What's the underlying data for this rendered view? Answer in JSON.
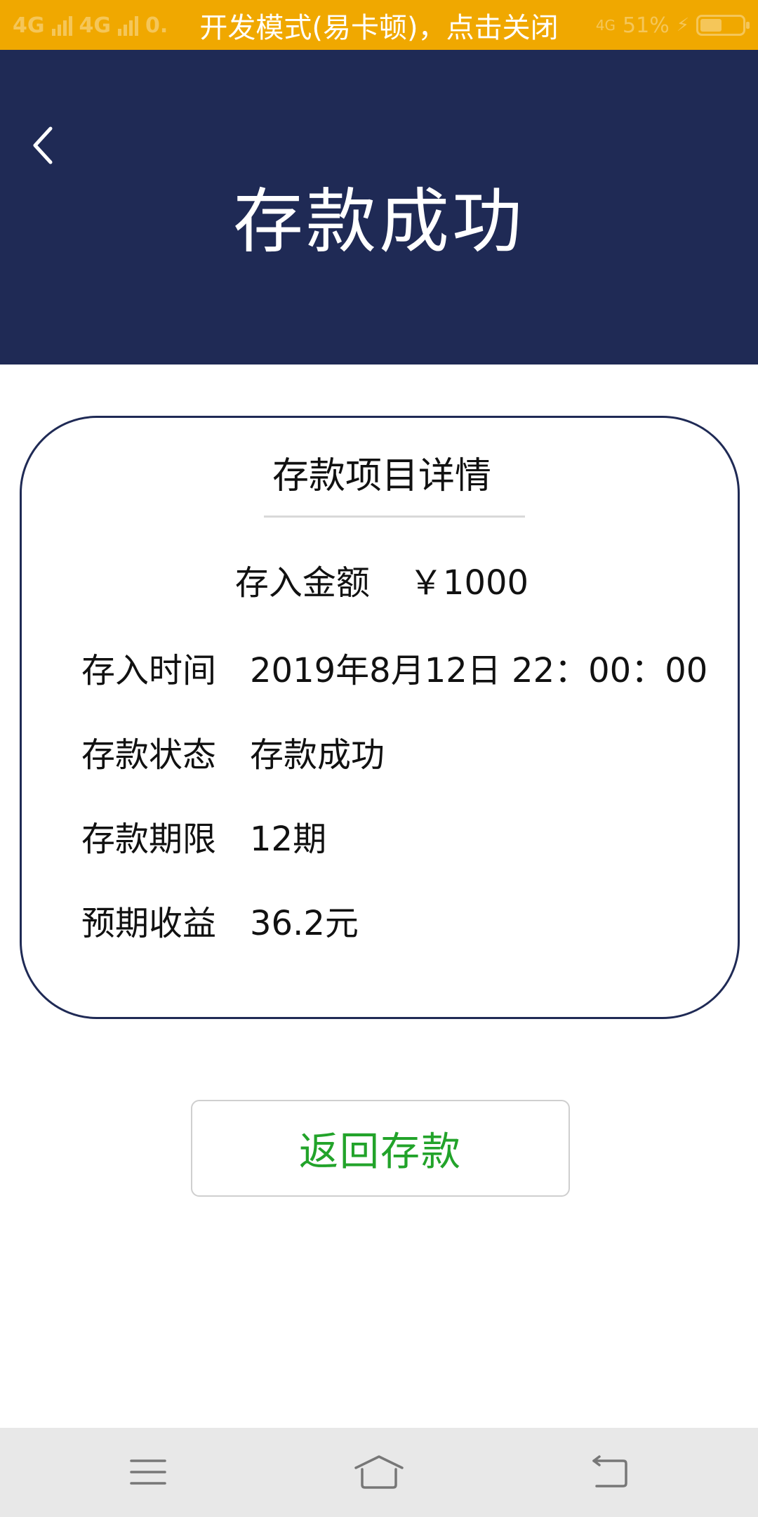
{
  "status_bar": {
    "signal_1": "4G",
    "signal_2": "4G",
    "speed": "0.",
    "network_right": "4G",
    "battery_text": "51%",
    "battery_level": 0.51,
    "charging_icon": "bolt-icon"
  },
  "dev_banner": {
    "text": "开发模式(易卡顿)，点击关闭"
  },
  "header": {
    "back_icon": "chevron-left-icon",
    "title": "存款成功"
  },
  "card": {
    "title": "存款项目详情",
    "amount_label": "存入金额",
    "amount_value": "￥1000",
    "rows": [
      {
        "label": "存入时间",
        "value": "2019年8月12日 22：00：00"
      },
      {
        "label": "存款状态",
        "value": "存款成功"
      },
      {
        "label": "存款期限",
        "value": "12期"
      },
      {
        "label": "预期收益",
        "value": "36.2元"
      }
    ]
  },
  "return_button": {
    "label": "返回存款"
  },
  "nav": {
    "menu_icon": "menu-icon",
    "home_icon": "home-icon",
    "back_icon": "back-icon"
  },
  "colors": {
    "status_bar": "#f0a800",
    "header": "#1f2a55",
    "card_border": "#1f2a55",
    "return_text": "#22a32a",
    "nav_background": "#e8e8e8"
  }
}
